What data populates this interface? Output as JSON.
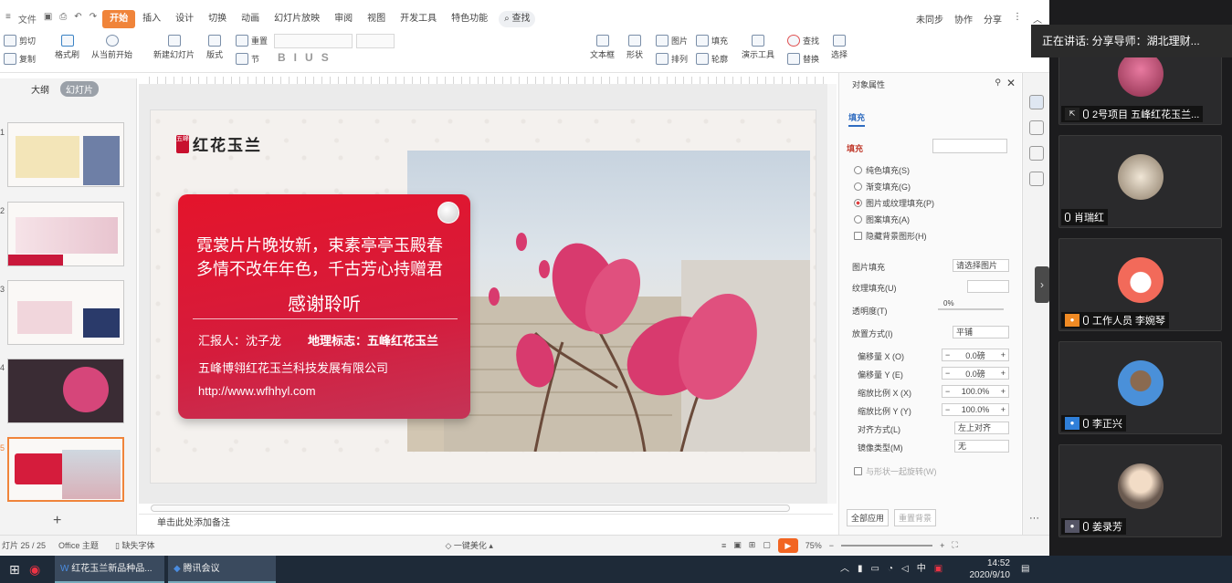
{
  "menu": {
    "file": "文件",
    "items": [
      "开始",
      "插入",
      "设计",
      "切换",
      "动画",
      "幻灯片放映",
      "审阅",
      "视图",
      "开发工具",
      "特色功能"
    ],
    "active": "开始",
    "search": "查找",
    "right": [
      "未同步",
      "协作",
      "分享"
    ]
  },
  "ribbon": {
    "cut": "剪切",
    "copy": "复制",
    "format_painter": "格式刷",
    "from_current": "从当前开始",
    "new_slide": "新建幻灯片",
    "layout": "版式",
    "reset": "重置",
    "section": "节",
    "textbox": "文本框",
    "shape": "形状",
    "picture": "图片",
    "fill": "填充",
    "arrange": "排列",
    "outline": "轮廓",
    "presentation_tools": "演示工具",
    "find": "查找",
    "replace": "替换",
    "select": "选择"
  },
  "thumbs": {
    "tab_outline": "大纲",
    "tab_slides": "幻灯片",
    "numbers": [
      "1",
      "2",
      "3",
      "4",
      "5"
    ],
    "add": "+"
  },
  "slide": {
    "logo_seal": "五峰",
    "logo_text": "红花玉兰",
    "poem_line1": "霓裳片片晚妆新，束素亭亭玉殿春",
    "poem_line2": "多情不改年年色，千古芳心持赠君",
    "thanks": "感谢聆听",
    "reporter": "汇报人：沈子龙",
    "geo_mark": "地理标志：五峰红花玉兰",
    "company": "五峰博翎红花玉兰科技发展有限公司",
    "url": "http://www.wfhhyl.com"
  },
  "notes": "单击此处添加备注",
  "panel": {
    "title": "对象属性",
    "tab": "填充",
    "section": "填充",
    "options": [
      "纯色填充(S)",
      "渐变填充(G)",
      "图片或纹理填充(P)",
      "图案填充(A)"
    ],
    "selected_option": "图片或纹理填充(P)",
    "hide_bg": "隐藏背景图形(H)",
    "image_fill_label": "图片填充",
    "image_fill_value": "请选择图片",
    "texture_fill_label": "纹理填充(U)",
    "transparency_label": "透明度(T)",
    "transparency_value": "0%",
    "placement_label": "放置方式(I)",
    "placement_value": "平铺",
    "offset_x_label": "偏移量 X (O)",
    "offset_x_value": "0.0磅",
    "offset_y_label": "偏移量 Y (E)",
    "offset_y_value": "0.0磅",
    "scale_x_label": "缩放比例 X (X)",
    "scale_x_value": "100.0%",
    "scale_y_label": "缩放比例 Y (Y)",
    "scale_y_value": "100.0%",
    "align_label": "对齐方式(L)",
    "align_value": "左上对齐",
    "mirror_label": "镜像类型(M)",
    "mirror_value": "无",
    "rotate_with_shape": "与形状一起旋转(W)",
    "apply_all": "全部应用",
    "reset_bg": "重置背景"
  },
  "status": {
    "slide_count": "灯片 25 / 25",
    "theme": "Office 主题",
    "missing_font": "缺失字体",
    "beautify": "一键美化",
    "zoom": "75%"
  },
  "taskbar": {
    "app1": "红花玉兰新品种品...",
    "app2": "腾讯会议",
    "time": "14:52",
    "date": "2020/9/10",
    "ime": "中"
  },
  "meeting": {
    "speaking": "正在讲话: 分享导师：湖北理财...",
    "participants": [
      {
        "name": "2号项目 五峰红花玉兰...",
        "avatar_color": "#d9577a"
      },
      {
        "name": "肖瑞红",
        "avatar_color": "#e8dcc8"
      },
      {
        "name": "工作人员 李婉琴",
        "avatar_color": "#f26a5a"
      },
      {
        "name": "李正兴",
        "avatar_color": "#4a90d9"
      },
      {
        "name": "姜录芳",
        "avatar_color": "#b8a89a"
      }
    ]
  },
  "colors": {
    "accent": "#f0843a",
    "card_red": "#d51c3c"
  }
}
